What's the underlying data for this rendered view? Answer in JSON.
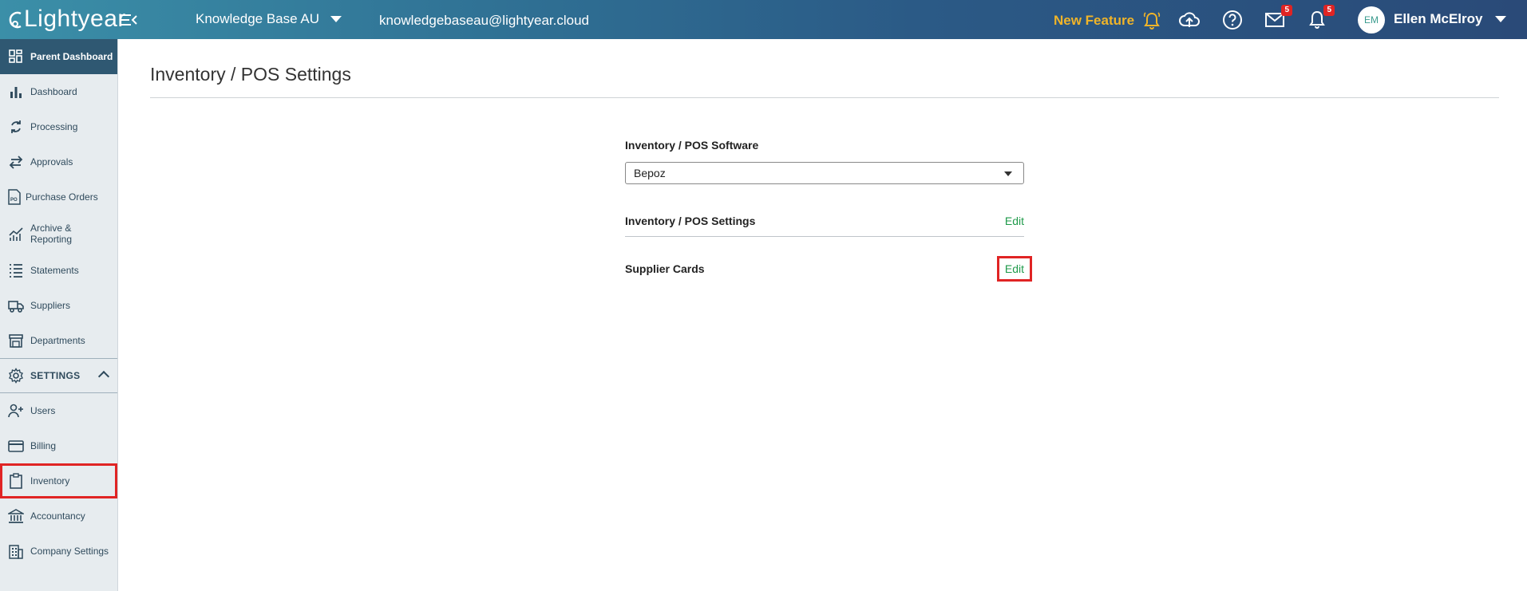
{
  "header": {
    "logo_text": "Lightyear",
    "workspace": "Knowledge Base AU",
    "email": "knowledgebaseau@lightyear.cloud",
    "new_feature": "New Feature",
    "mail_badge": "5",
    "notif_badge": "5",
    "avatar_initials": "EM",
    "user_name": "Ellen McElroy"
  },
  "sidebar": {
    "items": [
      {
        "label": "Parent Dashboard",
        "icon": "dashboard-grid-icon"
      },
      {
        "label": "Dashboard",
        "icon": "bar-chart-icon"
      },
      {
        "label": "Processing",
        "icon": "sync-icon"
      },
      {
        "label": "Approvals",
        "icon": "swap-arrows-icon"
      },
      {
        "label": "Purchase Orders",
        "icon": "po-document-icon"
      },
      {
        "label": "Archive & Reporting",
        "icon": "trend-chart-icon"
      },
      {
        "label": "Statements",
        "icon": "list-icon"
      },
      {
        "label": "Suppliers",
        "icon": "truck-icon"
      },
      {
        "label": "Departments",
        "icon": "store-icon"
      },
      {
        "label": "SETTINGS",
        "icon": "gear-icon"
      },
      {
        "label": "Users",
        "icon": "add-user-icon"
      },
      {
        "label": "Billing",
        "icon": "credit-card-icon"
      },
      {
        "label": "Inventory",
        "icon": "clipboard-icon"
      },
      {
        "label": "Accountancy",
        "icon": "bank-icon"
      },
      {
        "label": "Company Settings",
        "icon": "building-icon"
      }
    ]
  },
  "main": {
    "title": "Inventory / POS Settings",
    "software_label": "Inventory / POS Software",
    "software_value": "Bepoz",
    "settings_label": "Inventory / POS Settings",
    "settings_edit": "Edit",
    "supplier_label": "Supplier Cards",
    "supplier_edit": "Edit"
  },
  "colors": {
    "accent_green": "#1f9a4a",
    "new_feature": "#f0b429",
    "highlight": "#e02424",
    "sidebar_active": "#2f5872"
  }
}
